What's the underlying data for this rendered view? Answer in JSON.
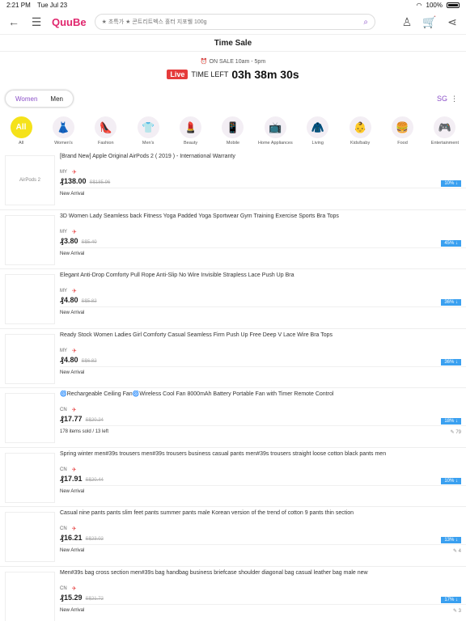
{
  "status": {
    "time": "2:21 PM",
    "date": "Tue Jul 23",
    "battery": "100%"
  },
  "search": {
    "placeholder": "★ 초특가 ★ 콘트리트벡스 홀터 지포웰 100g"
  },
  "logo": {
    "text": "QuuBe"
  },
  "page": {
    "title": "Time Sale"
  },
  "sale": {
    "on_sale": "ON SALE 10am - 5pm",
    "live": "Live",
    "time_left_label": "TIME LEFT",
    "countdown": "03h 38m 30s"
  },
  "gender": {
    "women": "Women",
    "men": "Men"
  },
  "region": {
    "code": "SG"
  },
  "categories": [
    {
      "label": "All",
      "icon": "All"
    },
    {
      "label": "Women's",
      "icon": "👗"
    },
    {
      "label": "Fashion",
      "icon": "👠"
    },
    {
      "label": "Men's",
      "icon": "👕"
    },
    {
      "label": "Beauty",
      "icon": "💄"
    },
    {
      "label": "Mobile",
      "icon": "📱"
    },
    {
      "label": "Home Appliances",
      "icon": "📺"
    },
    {
      "label": "Living",
      "icon": "🧥"
    },
    {
      "label": "Kids/baby",
      "icon": "👶"
    },
    {
      "label": "Food",
      "icon": "🍔"
    },
    {
      "label": "Entertainment",
      "icon": "🎮"
    }
  ],
  "items": [
    {
      "name": "[Brand New] Apple Original AirPods 2 ( 2019 ) - International Warranty",
      "origin": "MY",
      "price": "₰138.00",
      "old_price": "S$185.96",
      "discount": "10% ↓",
      "status": "New Arrival",
      "views": "",
      "thumb": "AirPods 2"
    },
    {
      "name": "3D Women Lady Seamless back Fitness Yoga Padded Yoga Sportwear Gym Training Exercise Sports Bra Tops",
      "origin": "MY",
      "price": "₰3.80",
      "old_price": "S$5.40",
      "discount": "45% ↓",
      "status": "New Arrival",
      "views": "",
      "thumb": ""
    },
    {
      "name": "Elegant Anti-Drop Comforty Pull Rope Anti-Slip No Wire Invisible Strapless Lace Push Up Bra",
      "origin": "MY",
      "price": "₰4.80",
      "old_price": "S$5.82",
      "discount": "36% ↓",
      "status": "New Arrival",
      "views": "",
      "thumb": ""
    },
    {
      "name": "Ready Stock Women Ladies Girl Comforty Casual Seamless Firm Push Up Free Deep V Lace Wire Bra Tops",
      "origin": "MY",
      "price": "₰4.80",
      "old_price": "S$6.82",
      "discount": "36% ↓",
      "status": "New Arrival",
      "views": "",
      "thumb": ""
    },
    {
      "name": "🌀Rechargeable Ceiling Fan🌀Wireless Cool Fan 8000mAh Battery Portable Fan with Timer Remote Control",
      "origin": "CN",
      "price": "₰17.77",
      "old_price": "S$20.24",
      "discount": "18% ↓",
      "status": "178 items sold / 13 left",
      "views": "79",
      "thumb": ""
    },
    {
      "name": "Spring winter men#39s trousers men#39s trousers business casual pants men#39s trousers straight loose cotton black pants men",
      "origin": "CN",
      "price": "₰17.91",
      "old_price": "S$20.44",
      "discount": "10% ↓",
      "status": "New Arrival",
      "views": "",
      "thumb": ""
    },
    {
      "name": "Casual nine pants pants slim feet pants summer pants male Korean version of the trend of cotton 9 pants thin section",
      "origin": "CN",
      "price": "₰16.21",
      "old_price": "S$23.02",
      "discount": "13% ↓",
      "status": "New Arrival",
      "views": "4",
      "thumb": ""
    },
    {
      "name": "Men#39s bag cross section men#39s bag handbag business briefcase shoulder diagonal bag casual leather bag male new",
      "origin": "CN",
      "price": "₰15.29",
      "old_price": "S$21.72",
      "discount": "17% ↓",
      "status": "New Arrival",
      "views": "3",
      "thumb": ""
    }
  ],
  "colors": {
    "accent": "#8b4fc8",
    "live": "#e53b3b",
    "discount": "#3aa0f0",
    "all": "#f5e21a"
  }
}
